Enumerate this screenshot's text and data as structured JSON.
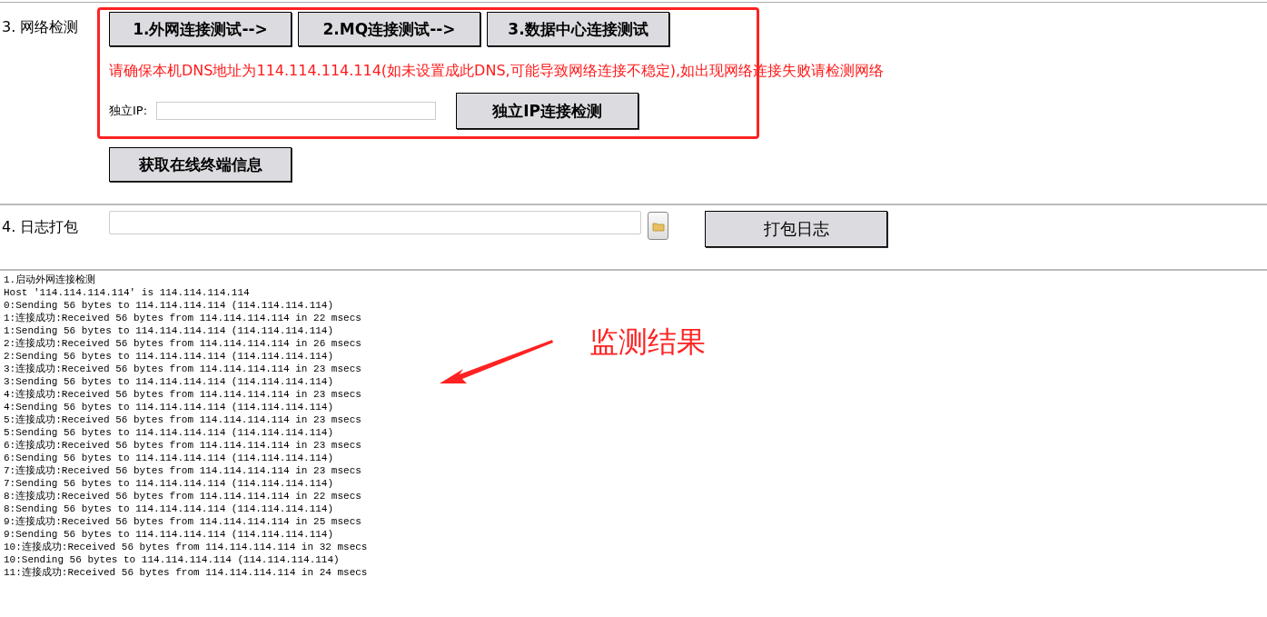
{
  "network_check": {
    "label": "3. 网络检测",
    "test_buttons": [
      "1.外网连接测试-->",
      "2.MQ连接测试-->",
      "3.数据中心连接测试"
    ],
    "notice": "请确保本机DNS地址为114.114.114.114(如未设置成此DNS,可能导致网络连接不稳定),如出现网络连接失败请检测网络",
    "ip_label": "独立IP:",
    "ip_button": "独立IP连接检测",
    "terminal_button": "获取在线终端信息"
  },
  "log_pack": {
    "label": "4. 日志打包",
    "button": "打包日志"
  },
  "log_output": [
    "1.启动外网连接检测",
    "Host '114.114.114.114' is 114.114.114.114",
    "0:Sending 56 bytes to 114.114.114.114 (114.114.114.114)",
    "1:连接成功:Received 56 bytes from 114.114.114.114 in 22 msecs",
    "1:Sending 56 bytes to 114.114.114.114 (114.114.114.114)",
    "2:连接成功:Received 56 bytes from 114.114.114.114 in 26 msecs",
    "2:Sending 56 bytes to 114.114.114.114 (114.114.114.114)",
    "3:连接成功:Received 56 bytes from 114.114.114.114 in 23 msecs",
    "3:Sending 56 bytes to 114.114.114.114 (114.114.114.114)",
    "4:连接成功:Received 56 bytes from 114.114.114.114 in 23 msecs",
    "4:Sending 56 bytes to 114.114.114.114 (114.114.114.114)",
    "5:连接成功:Received 56 bytes from 114.114.114.114 in 23 msecs",
    "5:Sending 56 bytes to 114.114.114.114 (114.114.114.114)",
    "6:连接成功:Received 56 bytes from 114.114.114.114 in 23 msecs",
    "6:Sending 56 bytes to 114.114.114.114 (114.114.114.114)",
    "7:连接成功:Received 56 bytes from 114.114.114.114 in 23 msecs",
    "7:Sending 56 bytes to 114.114.114.114 (114.114.114.114)",
    "8:连接成功:Received 56 bytes from 114.114.114.114 in 22 msecs",
    "8:Sending 56 bytes to 114.114.114.114 (114.114.114.114)",
    "9:连接成功:Received 56 bytes from 114.114.114.114 in 25 msecs",
    "9:Sending 56 bytes to 114.114.114.114 (114.114.114.114)",
    "10:连接成功:Received 56 bytes from 114.114.114.114 in 32 msecs",
    "10:Sending 56 bytes to 114.114.114.114 (114.114.114.114)",
    "11:连接成功:Received 56 bytes from 114.114.114.114 in 24 msecs"
  ],
  "annotation": {
    "text": "监测结果"
  }
}
